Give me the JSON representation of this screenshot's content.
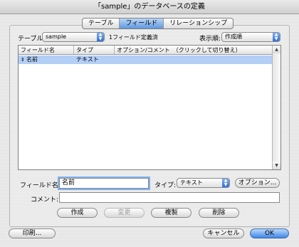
{
  "window": {
    "title": "「sample」のデータベースの定義"
  },
  "tabs": [
    {
      "label": "テーブル",
      "active": false
    },
    {
      "label": "フィールド",
      "active": true
    },
    {
      "label": "リレーションシップ",
      "active": false
    }
  ],
  "table_select": {
    "label": "テーブル:",
    "value": "sample",
    "info": "1フィールド定義済"
  },
  "sort_select": {
    "label": "表示順:",
    "value": "作成順"
  },
  "fields_table": {
    "columns": [
      "フィールド名",
      "タイプ",
      "オプション/コメント　（クリックして切り替え）"
    ],
    "rows": [
      {
        "name": "名前",
        "type": "テキスト",
        "options": ""
      }
    ]
  },
  "field_name": {
    "label": "フィールド名:",
    "value": "名前"
  },
  "type_select": {
    "label": "タイプ:",
    "value": "テキスト"
  },
  "options_button": "オプション...",
  "comment": {
    "label": "コメント:",
    "value": ""
  },
  "actions": {
    "create": "作成",
    "change": "変更",
    "duplicate": "複製",
    "delete": "削除"
  },
  "footer": {
    "print": "印刷...",
    "cancel": "キャンセル",
    "ok": "OK"
  },
  "colors": {
    "accent": "#3f86e6",
    "selection": "#b3cff6"
  },
  "icons": {
    "row_marker": "field-row-handle-icon"
  }
}
